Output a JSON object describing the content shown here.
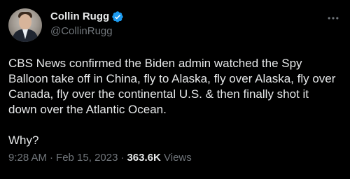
{
  "tweet": {
    "author": {
      "display_name": "Collin Rugg",
      "handle": "@CollinRugg",
      "verified": true,
      "verified_color": "#1d9bf0",
      "avatar_icon": "profile-photo"
    },
    "more_icon": "more-horizontal-icon",
    "text_paragraphs": [
      "CBS News confirmed the Biden admin watched the Spy Balloon take off in China, fly to Alaska, fly over Alaska, fly over Canada, fly over the continental U.S. & then finally shot it down over the Atlantic Ocean.",
      "Why?"
    ],
    "time": "9:28 AM",
    "separator": "·",
    "date": "Feb 15, 2023",
    "views_count": "363.6K",
    "views_label": "Views"
  },
  "colors": {
    "background": "#000000",
    "primary_text": "#e7e9ea",
    "secondary_text": "#71767b"
  }
}
